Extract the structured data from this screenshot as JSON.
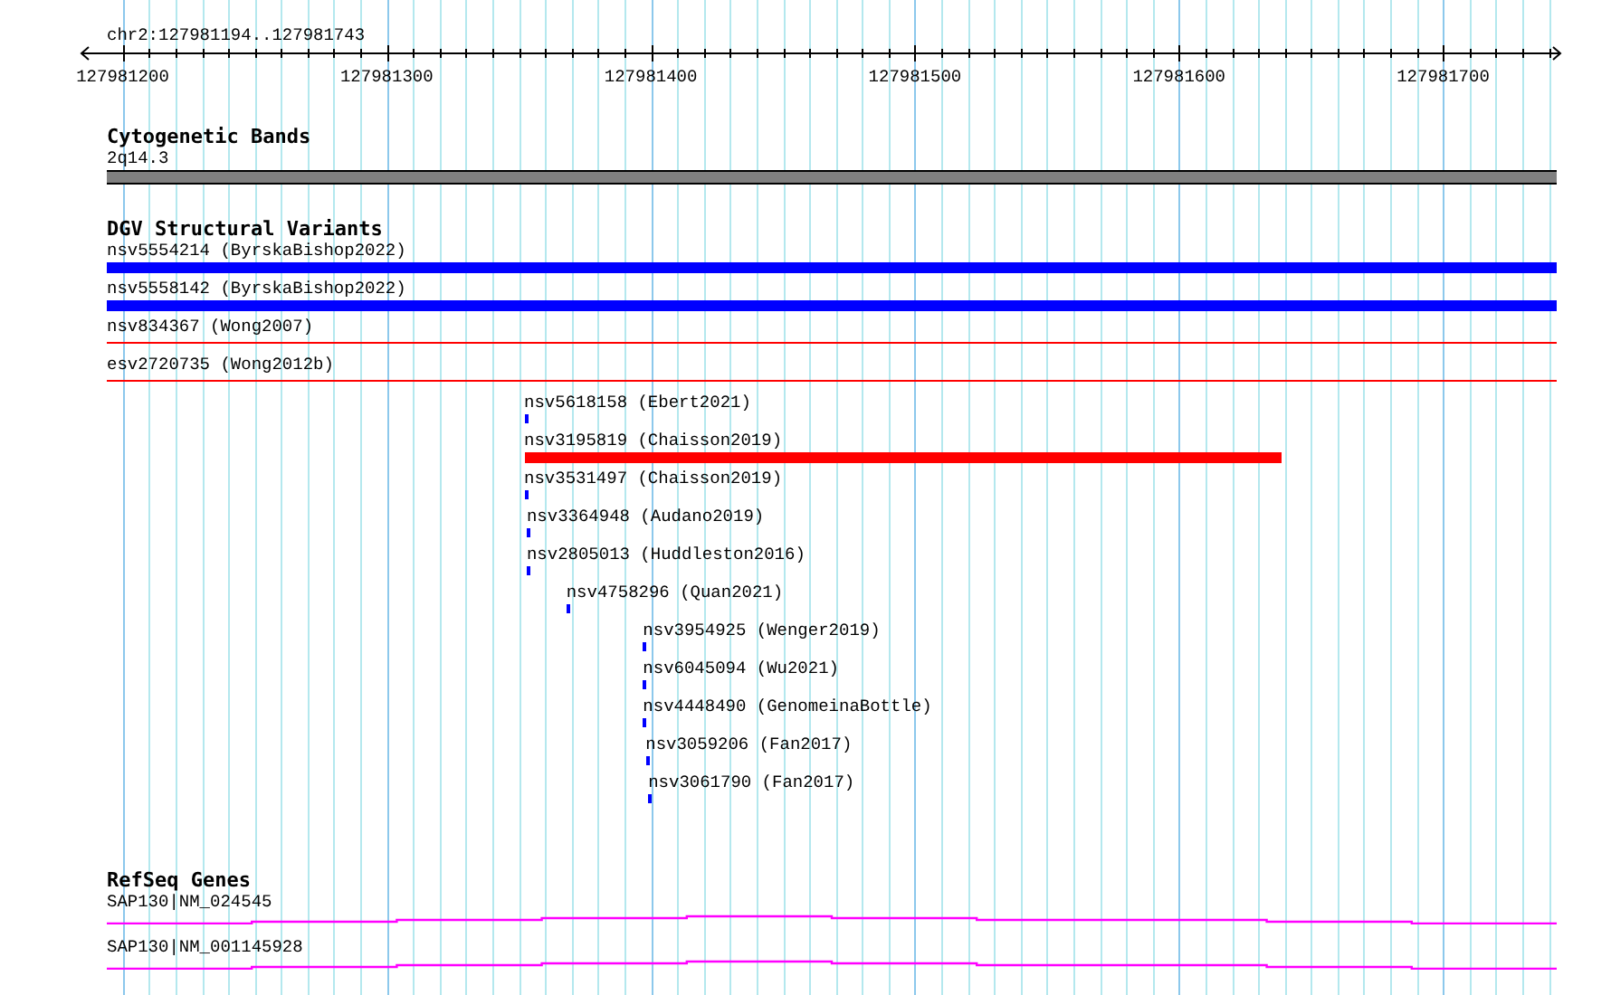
{
  "ruler": {
    "region": "chr2:127981194..127981743",
    "labels": [
      "127981200",
      "127981300",
      "127981400",
      "127981500",
      "127981600",
      "127981700"
    ]
  },
  "tracks": [
    {
      "kind": "bands",
      "title": "Cytogenetic Bands",
      "features": [
        {
          "label": "2q14.3"
        }
      ]
    },
    {
      "kind": "variants",
      "title": "DGV Structural Variants",
      "features": [
        {
          "label": "nsv5554214 (ByrskaBishop2022)",
          "color": "#0000ff",
          "kind": "thick"
        },
        {
          "label": "nsv5558142 (ByrskaBishop2022)",
          "color": "#0000ff",
          "kind": "thick"
        },
        {
          "label": "nsv834367 (Wong2007)",
          "color": "#ff0000",
          "kind": "thin"
        },
        {
          "label": "esv2720735 (Wong2012b)",
          "color": "#ff0000",
          "kind": "thin"
        },
        {
          "label": "nsv5618158 (Ebert2021)",
          "color": "#0000ff",
          "kind": "small"
        },
        {
          "label": "nsv3195819 (Chaisson2019)",
          "color": "#ff0000",
          "kind": "thick"
        },
        {
          "label": "nsv3531497 (Chaisson2019)",
          "color": "#0000ff",
          "kind": "small"
        },
        {
          "label": "nsv3364948 (Audano2019)",
          "color": "#0000ff",
          "kind": "small"
        },
        {
          "label": "nsv2805013 (Huddleston2016)",
          "color": "#0000ff",
          "kind": "small"
        },
        {
          "label": "nsv4758296 (Quan2021)",
          "color": "#0000ff",
          "kind": "small"
        },
        {
          "label": "nsv3954925 (Wenger2019)",
          "color": "#0000ff",
          "kind": "small"
        },
        {
          "label": "nsv6045094 (Wu2021)",
          "color": "#0000ff",
          "kind": "small"
        },
        {
          "label": "nsv4448490 (GenomeinaBottle)",
          "color": "#0000ff",
          "kind": "small"
        },
        {
          "label": "nsv3059206 (Fan2017)",
          "color": "#0000ff",
          "kind": "small"
        },
        {
          "label": "nsv3061790 (Fan2017)",
          "color": "#0000ff",
          "kind": "small"
        }
      ]
    },
    {
      "kind": "genes",
      "title": "RefSeq Genes",
      "features": [
        {
          "label": "SAP130|NM_024545"
        },
        {
          "label": "SAP130|NM_001145928"
        }
      ]
    }
  ]
}
